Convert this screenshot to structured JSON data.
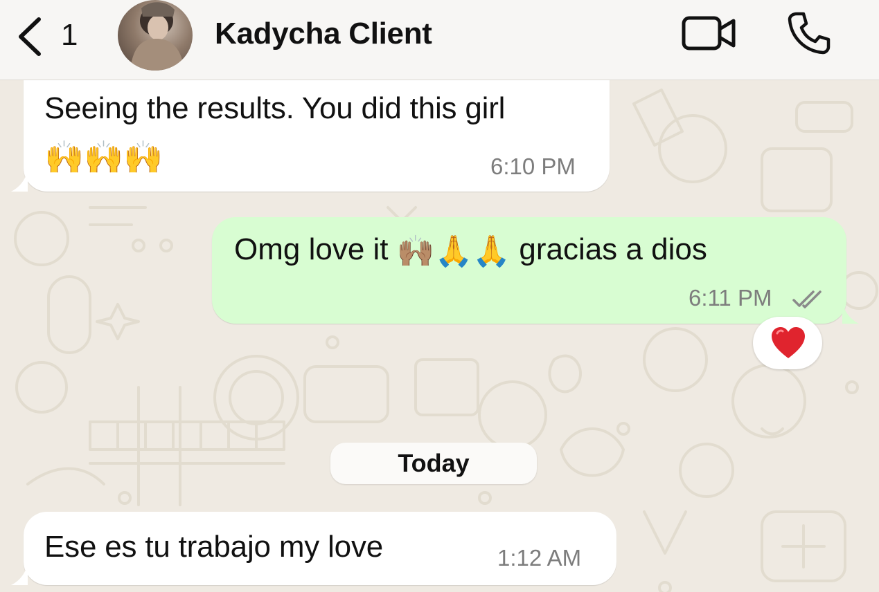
{
  "header": {
    "back_count": "1",
    "contact_name": "Kadycha Client"
  },
  "messages": [
    {
      "direction": "incoming",
      "text_line1": "Seeing the results. You did this girl",
      "emoji_line": "🙌🙌🙌",
      "time": "6:10 PM"
    },
    {
      "direction": "outgoing",
      "text_before_emoji": "Omg love it",
      "emoji": "🙌🏽🙏🙏",
      "text_after_emoji": "gracias a dios",
      "time": "6:11 PM",
      "read_receipt": "double-check-icon",
      "reaction": "❤️"
    },
    {
      "direction": "incoming",
      "text": "Ese es tu trabajo my love",
      "time": "1:12 AM"
    }
  ],
  "day_separator": "Today",
  "colors": {
    "wallpaper": "#efeae2",
    "incoming_bubble": "#ffffff",
    "outgoing_bubble": "#d8fdd2",
    "timestamp": "#7d7d7d",
    "read_receipt": "#8a8a8a",
    "heart": "#e0242e"
  }
}
